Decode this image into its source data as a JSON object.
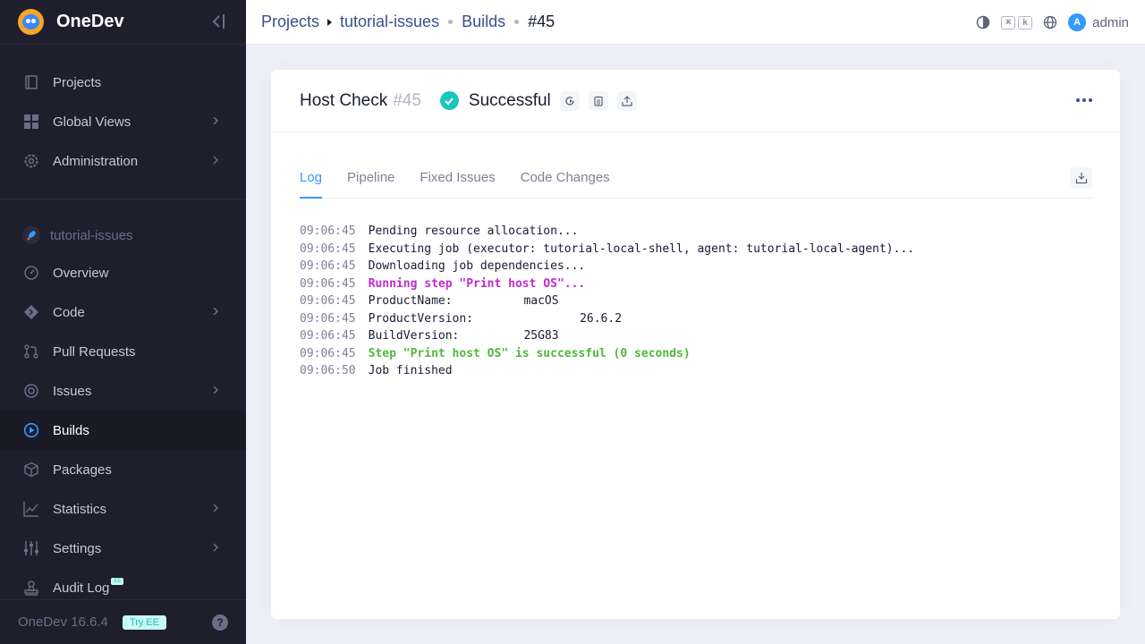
{
  "app": {
    "name": "OneDev",
    "version": "OneDev 16.6.4",
    "try_ee": "Try EE"
  },
  "sidebar": {
    "global_items": [
      {
        "label": "Projects",
        "icon": "projects-icon",
        "has_submenu": false
      },
      {
        "label": "Global Views",
        "icon": "grid-icon",
        "has_submenu": true
      },
      {
        "label": "Administration",
        "icon": "gear-icon",
        "has_submenu": true
      }
    ],
    "project": {
      "name": "tutorial-issues",
      "icon": "rocket-icon"
    },
    "project_items": [
      {
        "label": "Overview",
        "icon": "gauge-icon",
        "has_submenu": false
      },
      {
        "label": "Code",
        "icon": "code-icon",
        "has_submenu": true
      },
      {
        "label": "Pull Requests",
        "icon": "pull-request-icon",
        "has_submenu": false
      },
      {
        "label": "Issues",
        "icon": "issues-icon",
        "has_submenu": true
      },
      {
        "label": "Builds",
        "icon": "play-icon",
        "has_submenu": false,
        "active": true
      },
      {
        "label": "Packages",
        "icon": "package-icon",
        "has_submenu": false
      },
      {
        "label": "Statistics",
        "icon": "chart-icon",
        "has_submenu": true
      },
      {
        "label": "Settings",
        "icon": "sliders-icon",
        "has_submenu": true
      },
      {
        "label": "Audit Log",
        "icon": "stamp-icon",
        "has_submenu": false,
        "badge": "EE"
      }
    ]
  },
  "breadcrumb": {
    "projects": "Projects",
    "project": "tutorial-issues",
    "builds": "Builds",
    "current": "#45"
  },
  "topbar": {
    "shortcut_keys": [
      "⌘",
      "k"
    ],
    "user": {
      "initial": "A",
      "name": "admin"
    }
  },
  "build": {
    "job_name": "Host Check",
    "number": "#45",
    "status": "Successful",
    "status_color": "#1bc5bd"
  },
  "tabs": [
    {
      "label": "Log",
      "active": true
    },
    {
      "label": "Pipeline",
      "active": false
    },
    {
      "label": "Fixed Issues",
      "active": false
    },
    {
      "label": "Code Changes",
      "active": false
    }
  ],
  "log": [
    {
      "time": "09:06:45",
      "text": "Pending resource allocation...",
      "style": "normal"
    },
    {
      "time": "09:06:45",
      "text": "Executing job (executor: tutorial-local-shell, agent: tutorial-local-agent)...",
      "style": "normal"
    },
    {
      "time": "09:06:45",
      "text": "Downloading job dependencies...",
      "style": "normal"
    },
    {
      "time": "09:06:45",
      "text": "Running step \"Print host OS\"...",
      "style": "step"
    },
    {
      "time": "09:06:45",
      "text": "ProductName:\t\tmacOS",
      "style": "normal"
    },
    {
      "time": "09:06:45",
      "text": "ProductVersion:\t\t26.6.2",
      "style": "normal"
    },
    {
      "time": "09:06:45",
      "text": "BuildVersion:\t\t25G83",
      "style": "normal"
    },
    {
      "time": "09:06:45",
      "text": "Step \"Print host OS\" is successful (0 seconds)",
      "style": "success"
    },
    {
      "time": "09:06:50",
      "text": "Job finished",
      "style": "normal"
    }
  ],
  "colors": {
    "sidebar_bg": "#1e1e2d",
    "accent": "#3699ff",
    "step": "#c22ac9",
    "success": "#50b83c"
  }
}
